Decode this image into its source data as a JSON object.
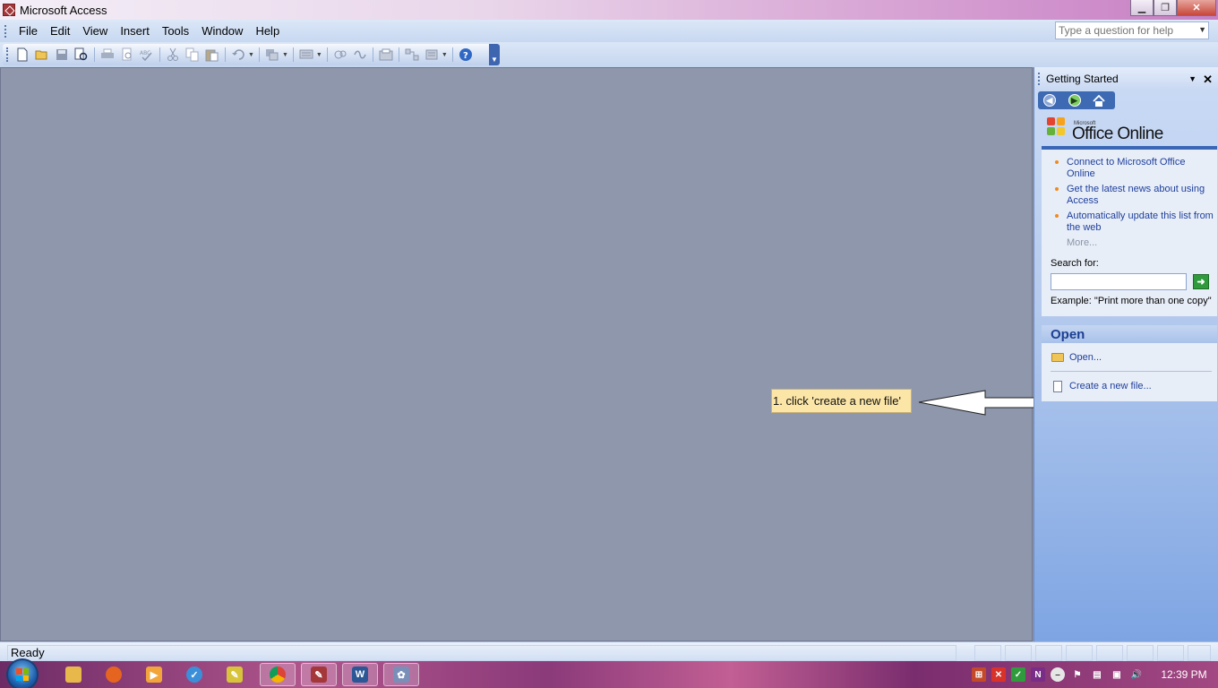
{
  "window": {
    "title": "Microsoft Access",
    "minimize_label": "▁",
    "restore_label": "❐",
    "close_label": "✕"
  },
  "menu": {
    "items": [
      "File",
      "Edit",
      "View",
      "Insert",
      "Tools",
      "Window",
      "Help"
    ],
    "help_placeholder": "Type a question for help"
  },
  "toolbar": {
    "icons": [
      "new-icon",
      "open-icon",
      "save-icon",
      "file-search-icon",
      "print-icon",
      "print-preview-icon",
      "spelling-icon",
      "cut-icon",
      "copy-icon",
      "paste-icon",
      "undo-icon",
      "office-links-icon",
      "analyze-icon",
      "code-icon",
      "script-editor-icon",
      "properties-icon",
      "relationships-icon",
      "new-object-icon",
      "help-icon"
    ]
  },
  "annotation": {
    "text": "1. click 'create a new file'"
  },
  "task_pane": {
    "title": "Getting Started",
    "logo_small": "Microsoft",
    "logo_text": "Office Online",
    "online_links": [
      "Connect to Microsoft Office Online",
      "Get the latest news about using Access",
      "Automatically update this list from the web"
    ],
    "more_link": "More...",
    "search_label": "Search for:",
    "search_value": "",
    "example_text": "Example:  \"Print more than one copy\"",
    "open_header": "Open",
    "open_link": "Open...",
    "create_link": "Create a new file..."
  },
  "status": {
    "text": "Ready"
  },
  "taskbar": {
    "clock": "12:39 PM"
  },
  "colors": {
    "workspace": "#8e97ab",
    "link": "#1e3f9b",
    "bullet": "#f08b1c",
    "callout": "#fbe5a7"
  }
}
